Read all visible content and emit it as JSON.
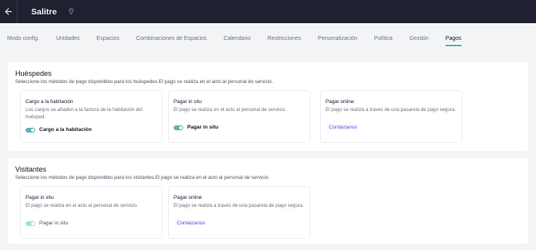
{
  "app": {
    "title": "Salitre",
    "back_icon": "arrow-left-icon",
    "pin_icon": "location-pin-icon"
  },
  "tabs": [
    {
      "label": "Modo config."
    },
    {
      "label": "Unidades"
    },
    {
      "label": "Espacios"
    },
    {
      "label": "Combinaciones de Espacios"
    },
    {
      "label": "Calendario"
    },
    {
      "label": "Restricciones"
    },
    {
      "label": "Personalización"
    },
    {
      "label": "Política"
    },
    {
      "label": "Gestión"
    },
    {
      "label": "Pagos",
      "active": true
    }
  ],
  "guests": {
    "title": "Huéspedes",
    "description": "Seleccione los métodos de pago disponibles para los huéspedes.El pago se realiza en el acto al personal de servicio.",
    "cards": {
      "room_charge": {
        "title": "Cargo a la habitación",
        "description": "Los cargos se añaden a la factura de la habitación del huésped.",
        "toggle_label": "Cargo a la habitación",
        "enabled": true
      },
      "pay_on_site": {
        "title": "Pagar in situ",
        "description": "El pago se realiza en el acto al personal de servicio.",
        "toggle_label": "Pagar in situ",
        "enabled": true
      },
      "pay_online": {
        "title": "Pagar online",
        "description": "El pago se realiza a través de una pasarela de pago segura.",
        "link": "Contáctanos"
      }
    }
  },
  "visitors": {
    "title": "Visitantes",
    "description": "Seleccione los métodos de pago disponibles para los visitantes.El pago se realiza en el acto al personal de servicio.",
    "cards": {
      "pay_on_site": {
        "title": "Pagar in situ",
        "description": "El pago se realiza en el acto al personal de servicio.",
        "toggle_label": "Pagar in situ",
        "enabled": true,
        "disabled_style": true
      },
      "pay_online": {
        "title": "Pagar online",
        "description": "El pago se realiza a través de una pasarela de pago segura.",
        "link": "Contáctanos"
      }
    }
  },
  "colors": {
    "topbar": "#1f2030",
    "accent": "#5ab5b0",
    "link": "#4f46e5",
    "background": "#f3f4f6"
  }
}
